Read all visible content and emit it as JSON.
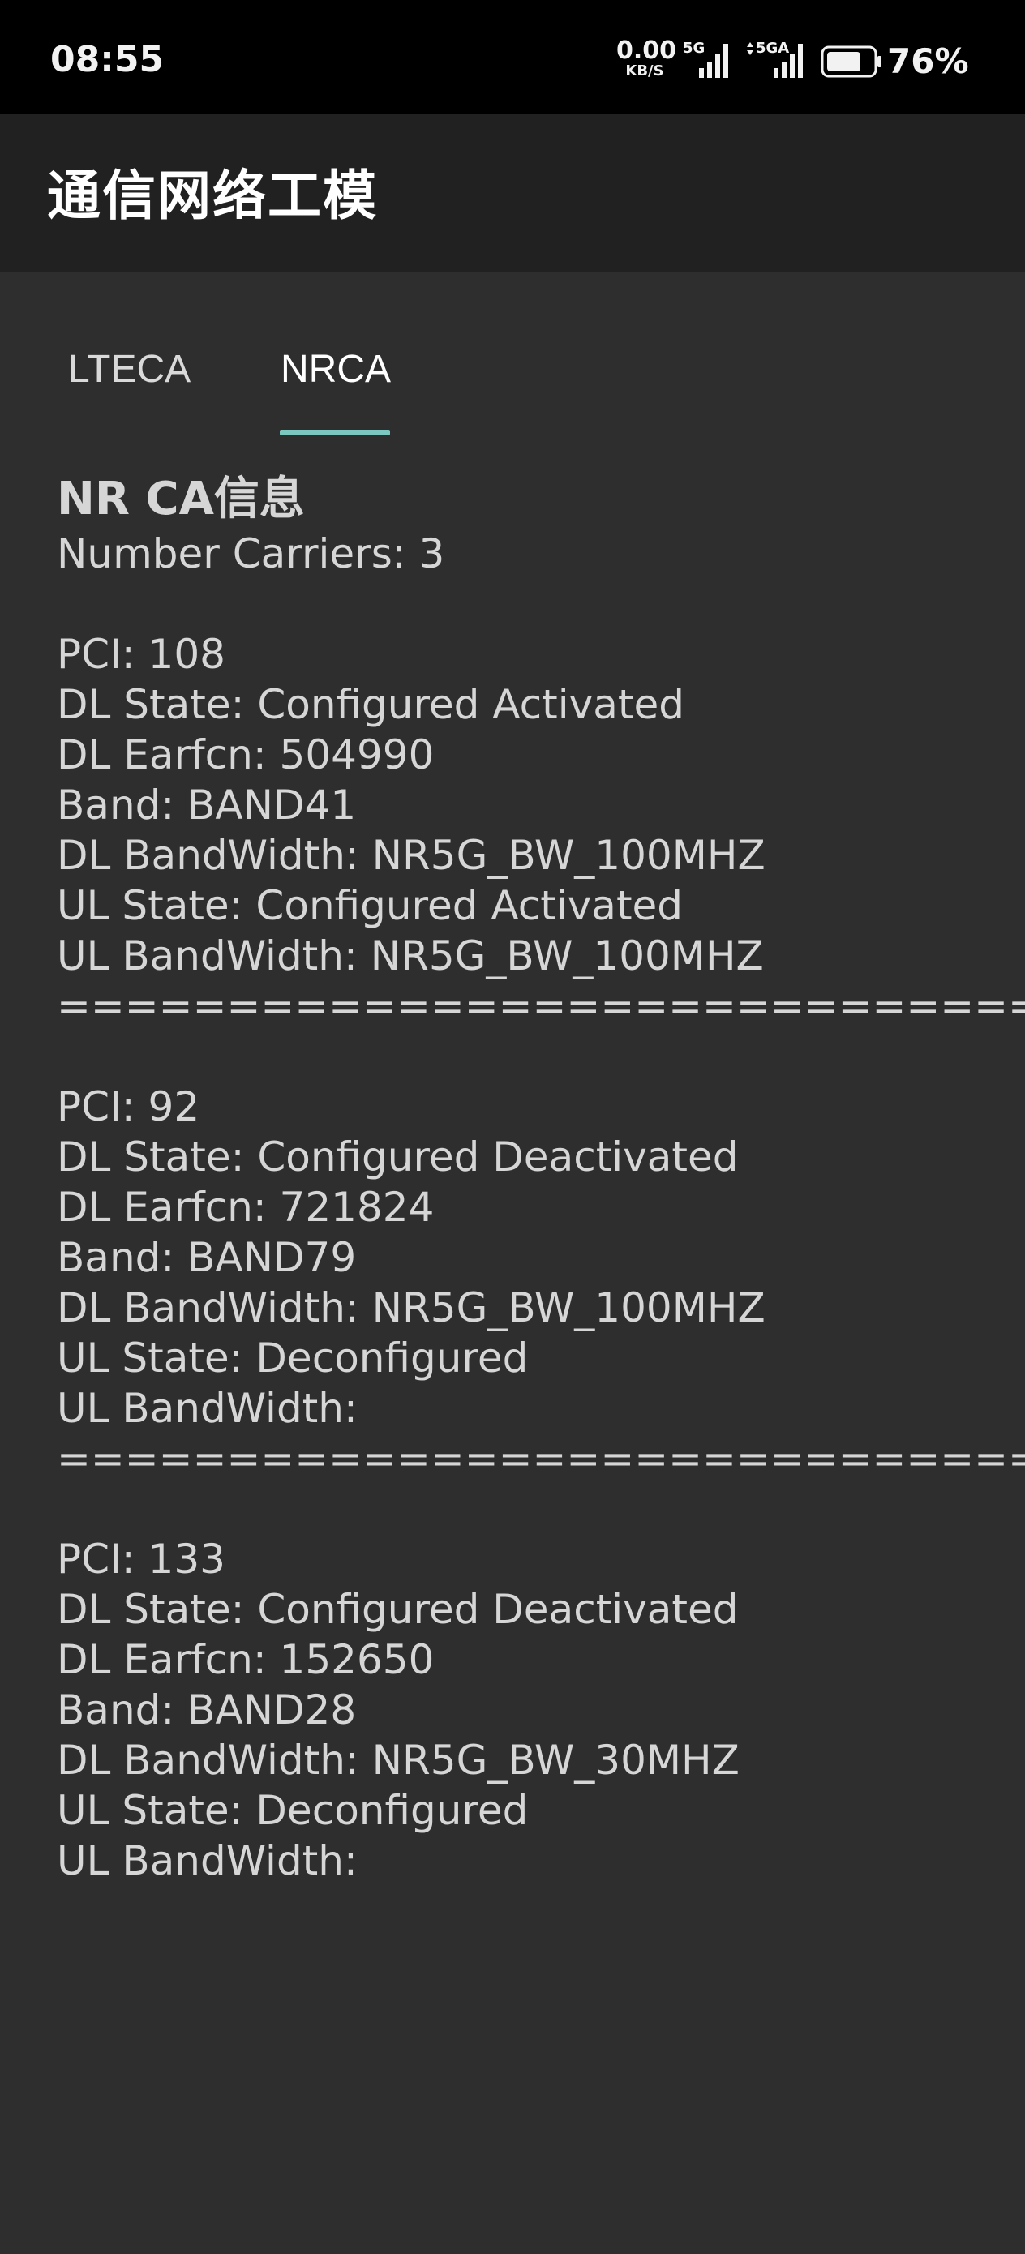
{
  "status_bar": {
    "time": "08:55",
    "net_speed_value": "0.00",
    "net_speed_unit": "KB/S",
    "sim1_tag": "5G",
    "sim2_tag": "5GA",
    "battery_percent": "76%",
    "battery_level": 0.76
  },
  "app_bar": {
    "title": "通信网络工模"
  },
  "tabs": [
    {
      "label": "LTECA",
      "selected": false
    },
    {
      "label": "NRCA",
      "selected": true
    }
  ],
  "nrca": {
    "title": "NR CA信息",
    "number_carriers": "Number Carriers: 3",
    "carriers": [
      {
        "pci": "PCI: 108",
        "dl_state": "DL State: Configured Activated",
        "dl_earfcn": "DL Earfcn: 504990",
        "band": "Band: BAND41",
        "dl_bandwidth": "DL BandWidth: NR5G_BW_100MHZ",
        "ul_state": "UL State: Configured Activated",
        "ul_bandwidth": "UL BandWidth: NR5G_BW_100MHZ",
        "separator": "=============================="
      },
      {
        "pci": "PCI: 92",
        "dl_state": "DL State: Configured Deactivated",
        "dl_earfcn": "DL Earfcn: 721824",
        "band": "Band: BAND79",
        "dl_bandwidth": "DL BandWidth: NR5G_BW_100MHZ",
        "ul_state": "UL State: Deconfigured",
        "ul_bandwidth": "UL BandWidth:",
        "separator": "=============================="
      },
      {
        "pci": "PCI: 133",
        "dl_state": "DL State: Configured Deactivated",
        "dl_earfcn": "DL Earfcn: 152650",
        "band": "Band: BAND28",
        "dl_bandwidth": "DL BandWidth: NR5G_BW_30MHZ",
        "ul_state": "UL State: Deconfigured",
        "ul_bandwidth": "UL BandWidth:"
      }
    ]
  },
  "colors": {
    "background": "#2e2e2e",
    "app_bar": "#212121",
    "status_bar": "#000000",
    "tab_indicator": "#7cc7c0",
    "text": "#d6d6d6"
  },
  "icons": [
    "signal-5g-icon",
    "signal-5ga-icon",
    "battery-icon"
  ]
}
